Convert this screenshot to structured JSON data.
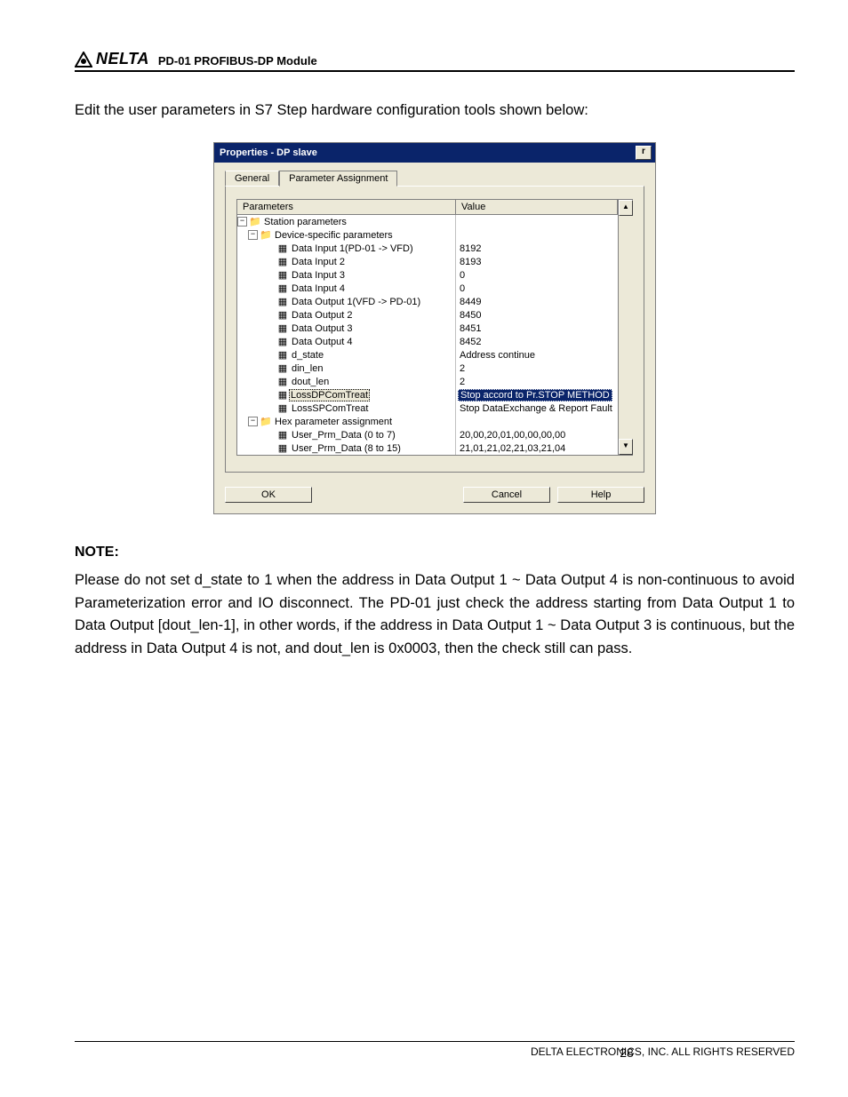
{
  "header": {
    "brand": "NELTA",
    "doc_title": "PD-01 PROFIBUS-DP Module"
  },
  "intro_text": "Edit the user parameters in S7 Step hardware configuration tools shown below:",
  "dialog": {
    "title": "Properties - DP slave",
    "tabs": {
      "general": "General",
      "param": "Parameter Assignment"
    },
    "columns": {
      "param": "Parameters",
      "value": "Value"
    },
    "buttons": {
      "ok": "OK",
      "cancel": "Cancel",
      "help": "Help"
    },
    "tree": {
      "station": "Station parameters",
      "device": "Device-specific parameters",
      "hex": "Hex parameter assignment",
      "leaves": [
        {
          "label": "Data Input 1(PD-01 -> VFD)",
          "value": "8192"
        },
        {
          "label": "Data Input 2",
          "value": "8193"
        },
        {
          "label": "Data Input 3",
          "value": "0"
        },
        {
          "label": "Data Input 4",
          "value": "0"
        },
        {
          "label": "Data Output 1(VFD -> PD-01)",
          "value": "8449"
        },
        {
          "label": "Data Output 2",
          "value": "8450"
        },
        {
          "label": "Data Output 3",
          "value": "8451"
        },
        {
          "label": "Data Output 4",
          "value": "8452"
        },
        {
          "label": "d_state",
          "value": "Address continue"
        },
        {
          "label": "din_len",
          "value": "2"
        },
        {
          "label": "dout_len",
          "value": "2"
        },
        {
          "label": "LossDPComTreat",
          "value": "Stop accord to Pr.STOP METHOD"
        },
        {
          "label": "LossSPComTreat",
          "value": "Stop DataExchange & Report Fault"
        }
      ],
      "hex_leaves": [
        {
          "label": "User_Prm_Data (0 to 7)",
          "value": "20,00,20,01,00,00,00,00"
        },
        {
          "label": "User_Prm_Data (8 to 15)",
          "value": "21,01,21,02,21,03,21,04"
        }
      ]
    }
  },
  "note": {
    "heading": "NOTE:",
    "body": "Please do not set d_state to 1 when the address in Data Output 1 ~ Data Output 4 is non-continuous to avoid Parameterization error and IO disconnect. The PD-01 just check the address starting from Data Output 1 to Data Output [dout_len-1], in other words, if the address in Data Output 1 ~ Data Output 3 is continuous, but the address in Data Output 4 is not, and dout_len is 0x0003, then the check still can pass."
  },
  "footer": {
    "page": "28",
    "copyright": "DELTA ELECTRONICS, INC. ALL RIGHTS RESERVED"
  }
}
